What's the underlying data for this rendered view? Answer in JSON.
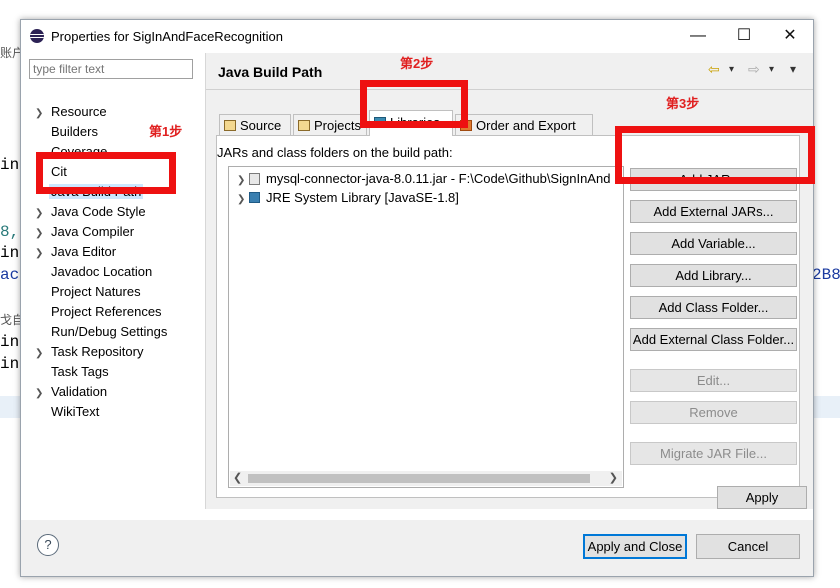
{
  "background": {
    "fragments": [
      "账户",
      "in",
      "8,",
      "in",
      "ac",
      "2B8",
      "戈自",
      "in",
      "in"
    ]
  },
  "window": {
    "title": "Properties for SigInAndFaceRecognition",
    "minimize": "—",
    "maximize": "☐",
    "close": "✕",
    "app_icon": "eclipse-icon"
  },
  "sidebar": {
    "filter_placeholder": "type filter text",
    "items": [
      {
        "label": "Resource",
        "expandable": true
      },
      {
        "label": "Builders",
        "expandable": false
      },
      {
        "label": "Coverage",
        "expandable": false
      },
      {
        "label": "Cit",
        "expandable": false
      },
      {
        "label": "Java Build Path",
        "expandable": false,
        "selected": true
      },
      {
        "label": "Java Code Style",
        "expandable": true
      },
      {
        "label": "Java Compiler",
        "expandable": true
      },
      {
        "label": "Java Editor",
        "expandable": true
      },
      {
        "label": "Javadoc Location",
        "expandable": false
      },
      {
        "label": "Project Natures",
        "expandable": false
      },
      {
        "label": "Project References",
        "expandable": false
      },
      {
        "label": "Run/Debug Settings",
        "expandable": false
      },
      {
        "label": "Task Repository",
        "expandable": true
      },
      {
        "label": "Task Tags",
        "expandable": false
      },
      {
        "label": "Validation",
        "expandable": true
      },
      {
        "label": "WikiText",
        "expandable": false
      }
    ]
  },
  "page": {
    "title": "Java Build Path",
    "nav_back": "⇦",
    "nav_forward": "⇨",
    "menu": "▾",
    "tabs": [
      {
        "label": "Source",
        "icon": "source-folder-icon"
      },
      {
        "label": "Projects",
        "icon": "projects-icon"
      },
      {
        "label": "Libraries",
        "icon": "libraries-icon",
        "active": true
      },
      {
        "label": "Order and Export",
        "icon": "order-export-icon"
      }
    ],
    "list_label": "JARs and class folders on the build path:",
    "entries": [
      {
        "label": "mysql-connector-java-8.0.11.jar - F:\\Code\\Github\\SignInAnd",
        "icon": "jar-icon"
      },
      {
        "label": "JRE System Library [JavaSE-1.8]",
        "icon": "library-icon"
      }
    ],
    "buttons": {
      "add_jars": "Add JARs...",
      "add_external_jars": "Add External JARs...",
      "add_variable": "Add Variable...",
      "add_library": "Add Library...",
      "add_class_folder": "Add Class Folder...",
      "add_external_class_folder": "Add External Class Folder...",
      "edit": "Edit...",
      "remove": "Remove",
      "migrate_jar": "Migrate JAR File..."
    },
    "apply": "Apply"
  },
  "footer": {
    "help": "?",
    "apply_and_close": "Apply and Close",
    "cancel": "Cancel"
  },
  "annotations": {
    "step1": "第1步",
    "step2": "第2步",
    "step3": "第3步",
    "color": "#ee1111"
  }
}
